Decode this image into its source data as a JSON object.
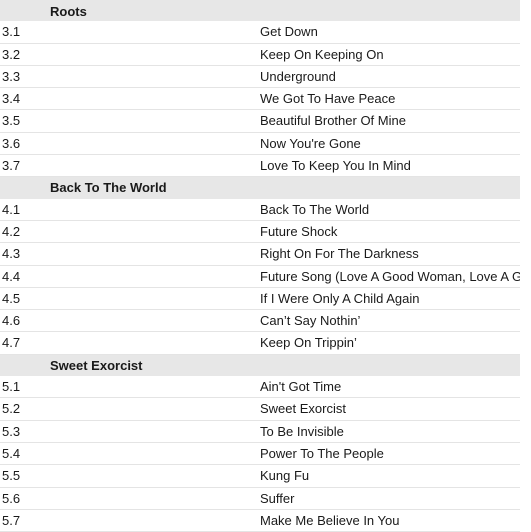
{
  "tracklist": {
    "sections": [
      {
        "heading": "Roots",
        "tracks": [
          {
            "number": "3.1",
            "title": "Get Down"
          },
          {
            "number": "3.2",
            "title": "Keep On Keeping On"
          },
          {
            "number": "3.3",
            "title": "Underground"
          },
          {
            "number": "3.4",
            "title": "We Got To Have Peace"
          },
          {
            "number": "3.5",
            "title": "Beautiful Brother Of Mine"
          },
          {
            "number": "3.6",
            "title": "Now You're Gone"
          },
          {
            "number": "3.7",
            "title": "Love To Keep You In Mind"
          }
        ]
      },
      {
        "heading": "Back To The World",
        "tracks": [
          {
            "number": "4.1",
            "title": "Back To The World"
          },
          {
            "number": "4.2",
            "title": "Future Shock"
          },
          {
            "number": "4.3",
            "title": "Right On For The Darkness"
          },
          {
            "number": "4.4",
            "title": "Future Song (Love A Good Woman, Love A Good Man)"
          },
          {
            "number": "4.5",
            "title": "If I Were Only A Child Again"
          },
          {
            "number": "4.6",
            "title": "Can’t Say Nothin’"
          },
          {
            "number": "4.7",
            "title": "Keep On Trippin’"
          }
        ]
      },
      {
        "heading": "Sweet Exorcist",
        "tracks": [
          {
            "number": "5.1",
            "title": "Ain't Got Time"
          },
          {
            "number": "5.2",
            "title": "Sweet Exorcist"
          },
          {
            "number": "5.3",
            "title": "To Be Invisible"
          },
          {
            "number": "5.4",
            "title": "Power To The People"
          },
          {
            "number": "5.5",
            "title": "Kung Fu"
          },
          {
            "number": "5.6",
            "title": "Suffer"
          },
          {
            "number": "5.7",
            "title": "Make Me Believe In You"
          }
        ]
      }
    ]
  },
  "colors": {
    "section_header_background": "#e7e7e7",
    "row_background": "#ffffff",
    "row_divider": "#e4e4e4",
    "text": "#1a1a1a"
  }
}
